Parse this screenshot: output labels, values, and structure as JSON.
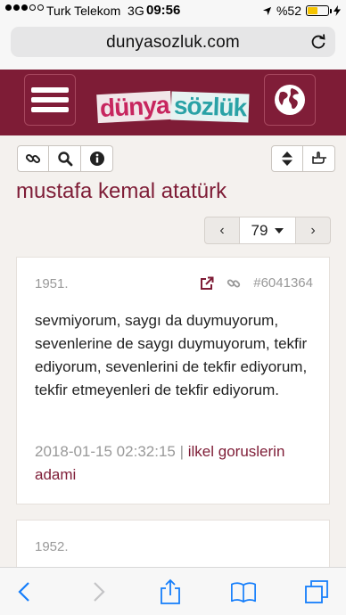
{
  "status": {
    "carrier": "Turk Telekom",
    "network": "3G",
    "time": "09:56",
    "battery": "%52",
    "battery_level": 0.52
  },
  "browser": {
    "url": "dunyasozluk.com"
  },
  "header": {
    "logo_part1": "dünya",
    "logo_part2": "sözlük"
  },
  "topic": {
    "title": "mustafa kemal atatürk"
  },
  "pager": {
    "prev": "‹",
    "current": "79",
    "next": "›"
  },
  "entries": [
    {
      "number": "1951.",
      "id": "#6041364",
      "text": "sevmiyorum, saygı da duymuyorum, sevenlerine de saygı duymuyorum, tekfir ediyorum, sevenlerini de tekfir ediyorum, tekfir etmeyenleri de tekfir ediyorum.",
      "date": "2018-01-15 02:32:15",
      "separator": "|",
      "author": "ilkel goruslerin adami"
    },
    {
      "number": "1952."
    }
  ],
  "colors": {
    "brand": "#7e1c36",
    "accent_ios": "#157efb",
    "page_bg": "#f4f1ee"
  }
}
